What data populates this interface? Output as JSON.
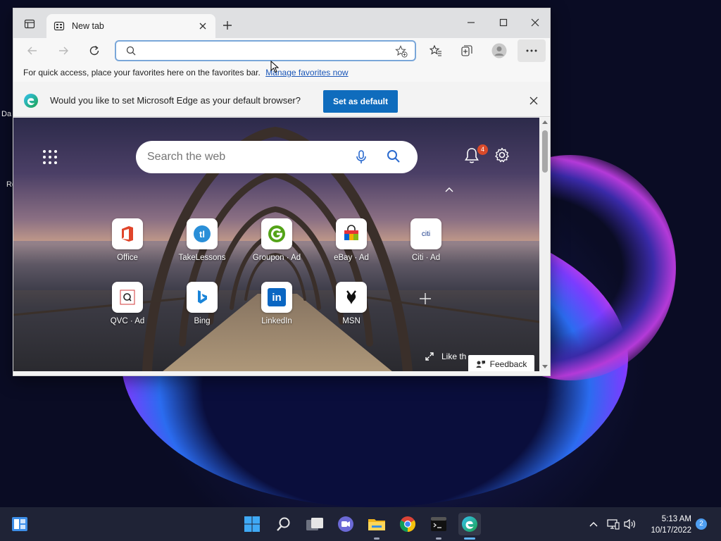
{
  "desktop": {
    "icon_labels": [
      "Da",
      "Re"
    ]
  },
  "browser": {
    "tab_title": "New tab",
    "address": {
      "value": "",
      "placeholder": ""
    },
    "favorites_bar": {
      "text": "For quick access, place your favorites here on the favorites bar.",
      "link": "Manage favorites now"
    },
    "infobar": {
      "text": "Would you like to set Microsoft Edge as your default browser?",
      "button": "Set as default"
    }
  },
  "new_tab_page": {
    "search_placeholder": "Search the web",
    "notification_count": "4",
    "tiles": [
      {
        "label": "Office",
        "icon": "office-icon"
      },
      {
        "label": "TakeLessons",
        "icon": "takelessons-icon"
      },
      {
        "label": "Groupon · Ad",
        "icon": "groupon-icon"
      },
      {
        "label": "eBay · Ad",
        "icon": "ebay-icon"
      },
      {
        "label": "Citi · Ad",
        "icon": "citi-icon",
        "icon_text": "citi"
      },
      {
        "label": "QVC · Ad",
        "icon": "qvc-icon"
      },
      {
        "label": "Bing",
        "icon": "bing-icon"
      },
      {
        "label": "LinkedIn",
        "icon": "linkedin-icon",
        "icon_text": "in"
      },
      {
        "label": "MSN",
        "icon": "msn-icon"
      }
    ],
    "like_text": "Like th",
    "feedback_label": "Feedback"
  },
  "taskbar": {
    "apps": [
      "widgets",
      "start",
      "search",
      "task-view",
      "chat",
      "file-explorer",
      "chrome",
      "terminal",
      "edge"
    ],
    "time": "5:13 AM",
    "date": "10/17/2022",
    "notification_count": "2"
  },
  "colors": {
    "accent": "#0f6cbd",
    "taskbar": "#1f2336",
    "badge": "#d94a2a"
  }
}
